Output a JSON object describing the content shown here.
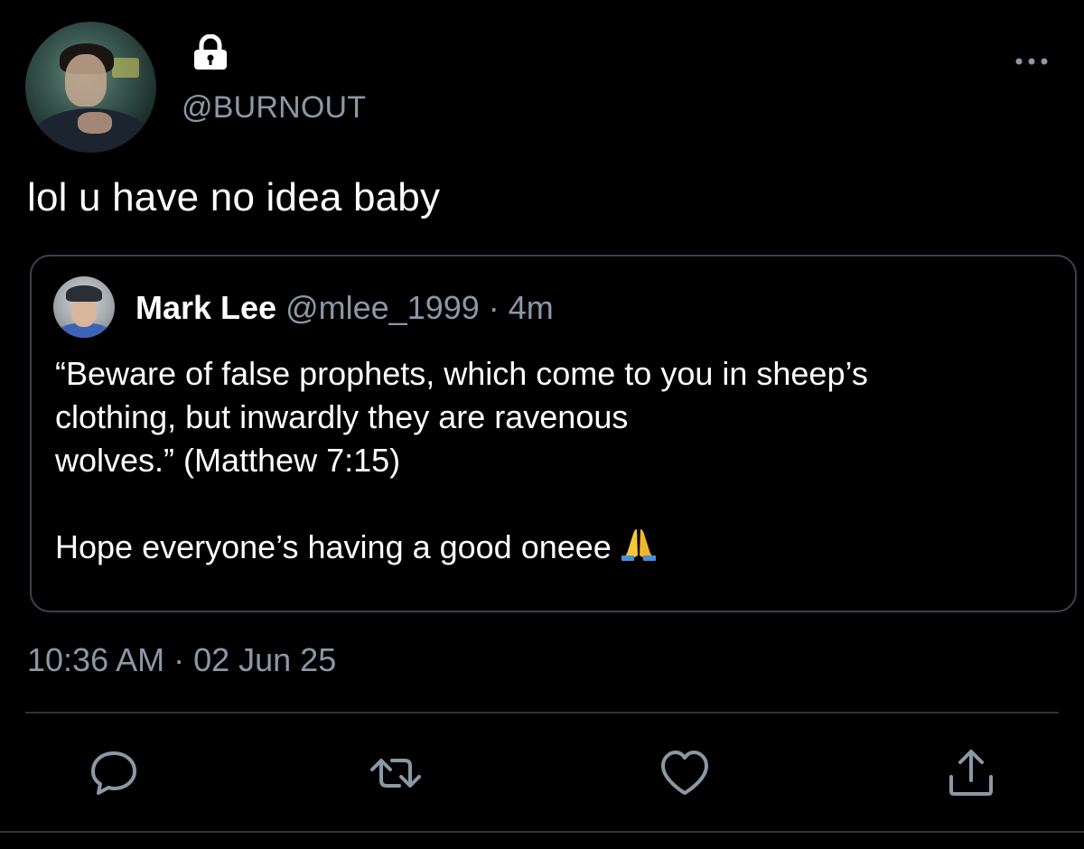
{
  "colors": {
    "background": "#000000",
    "primary_text": "#ffffff",
    "secondary_text": "#8b98a5",
    "border": "#38444d",
    "divider": "#2f3336"
  },
  "author": {
    "handle": "@BURNOUT",
    "protected_icon": "lock-icon",
    "avatar": "profile-photo"
  },
  "tweet": {
    "text": "lol u have no idea baby",
    "timestamp": "10:36 AM · 02 Jun 25"
  },
  "quoted_tweet": {
    "name": "Mark Lee",
    "handle_time": "@mlee_1999 · 4m",
    "lines": [
      "“Beware of false prophets, which come to you in sheep’s",
      "clothing, but inwardly they are ravenous",
      "wolves.” (Matthew 7:15)"
    ],
    "line2": "Hope everyone’s having a good oneee",
    "emoji": "folded-hands-emoji"
  },
  "actions": {
    "reply_icon": "reply-icon",
    "retweet_icon": "retweet-icon",
    "like_icon": "heart-icon",
    "share_icon": "share-icon",
    "more_icon": "more-options-icon"
  }
}
